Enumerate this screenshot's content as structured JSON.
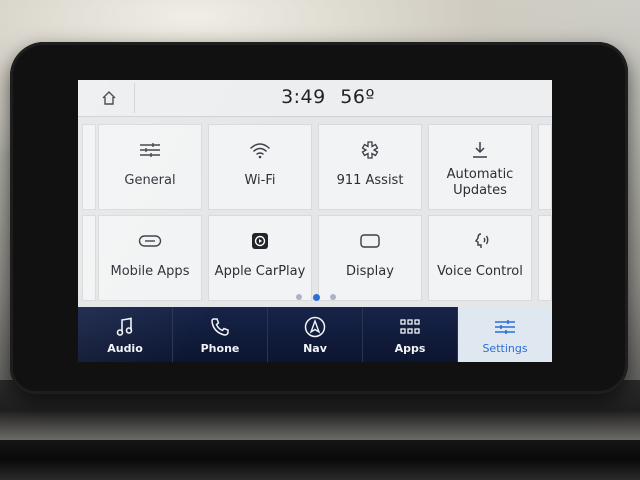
{
  "status_bar": {
    "time": "3:49",
    "temperature": "56º"
  },
  "tiles": [
    {
      "key": "general",
      "label": "General",
      "icon": "sliders-icon"
    },
    {
      "key": "wifi",
      "label": "Wi-Fi",
      "icon": "wifi-icon"
    },
    {
      "key": "assist",
      "label": "911 Assist",
      "icon": "emergency-icon"
    },
    {
      "key": "updates",
      "label": "Automatic Updates",
      "icon": "download-icon"
    },
    {
      "key": "mobile_apps",
      "label": "Mobile Apps",
      "icon": "link-icon"
    },
    {
      "key": "carplay",
      "label": "Apple CarPlay",
      "icon": "carplay-icon"
    },
    {
      "key": "display",
      "label": "Display",
      "icon": "display-icon"
    },
    {
      "key": "voice",
      "label": "Voice Control",
      "icon": "voice-icon"
    }
  ],
  "page_indicator": {
    "pages": 3,
    "current": 2
  },
  "nav_bar": [
    {
      "label": "Audio",
      "icon": "music-note-icon"
    },
    {
      "label": "Phone",
      "icon": "phone-icon"
    },
    {
      "label": "Nav",
      "icon": "compass-icon"
    },
    {
      "label": "Apps",
      "icon": "grid-icon"
    },
    {
      "label": "Settings",
      "icon": "sliders-icon"
    }
  ],
  "colors": {
    "accent": "#2b6fd6",
    "nav_background": "#0f1a33",
    "tile_background": "#f2f3f4"
  }
}
